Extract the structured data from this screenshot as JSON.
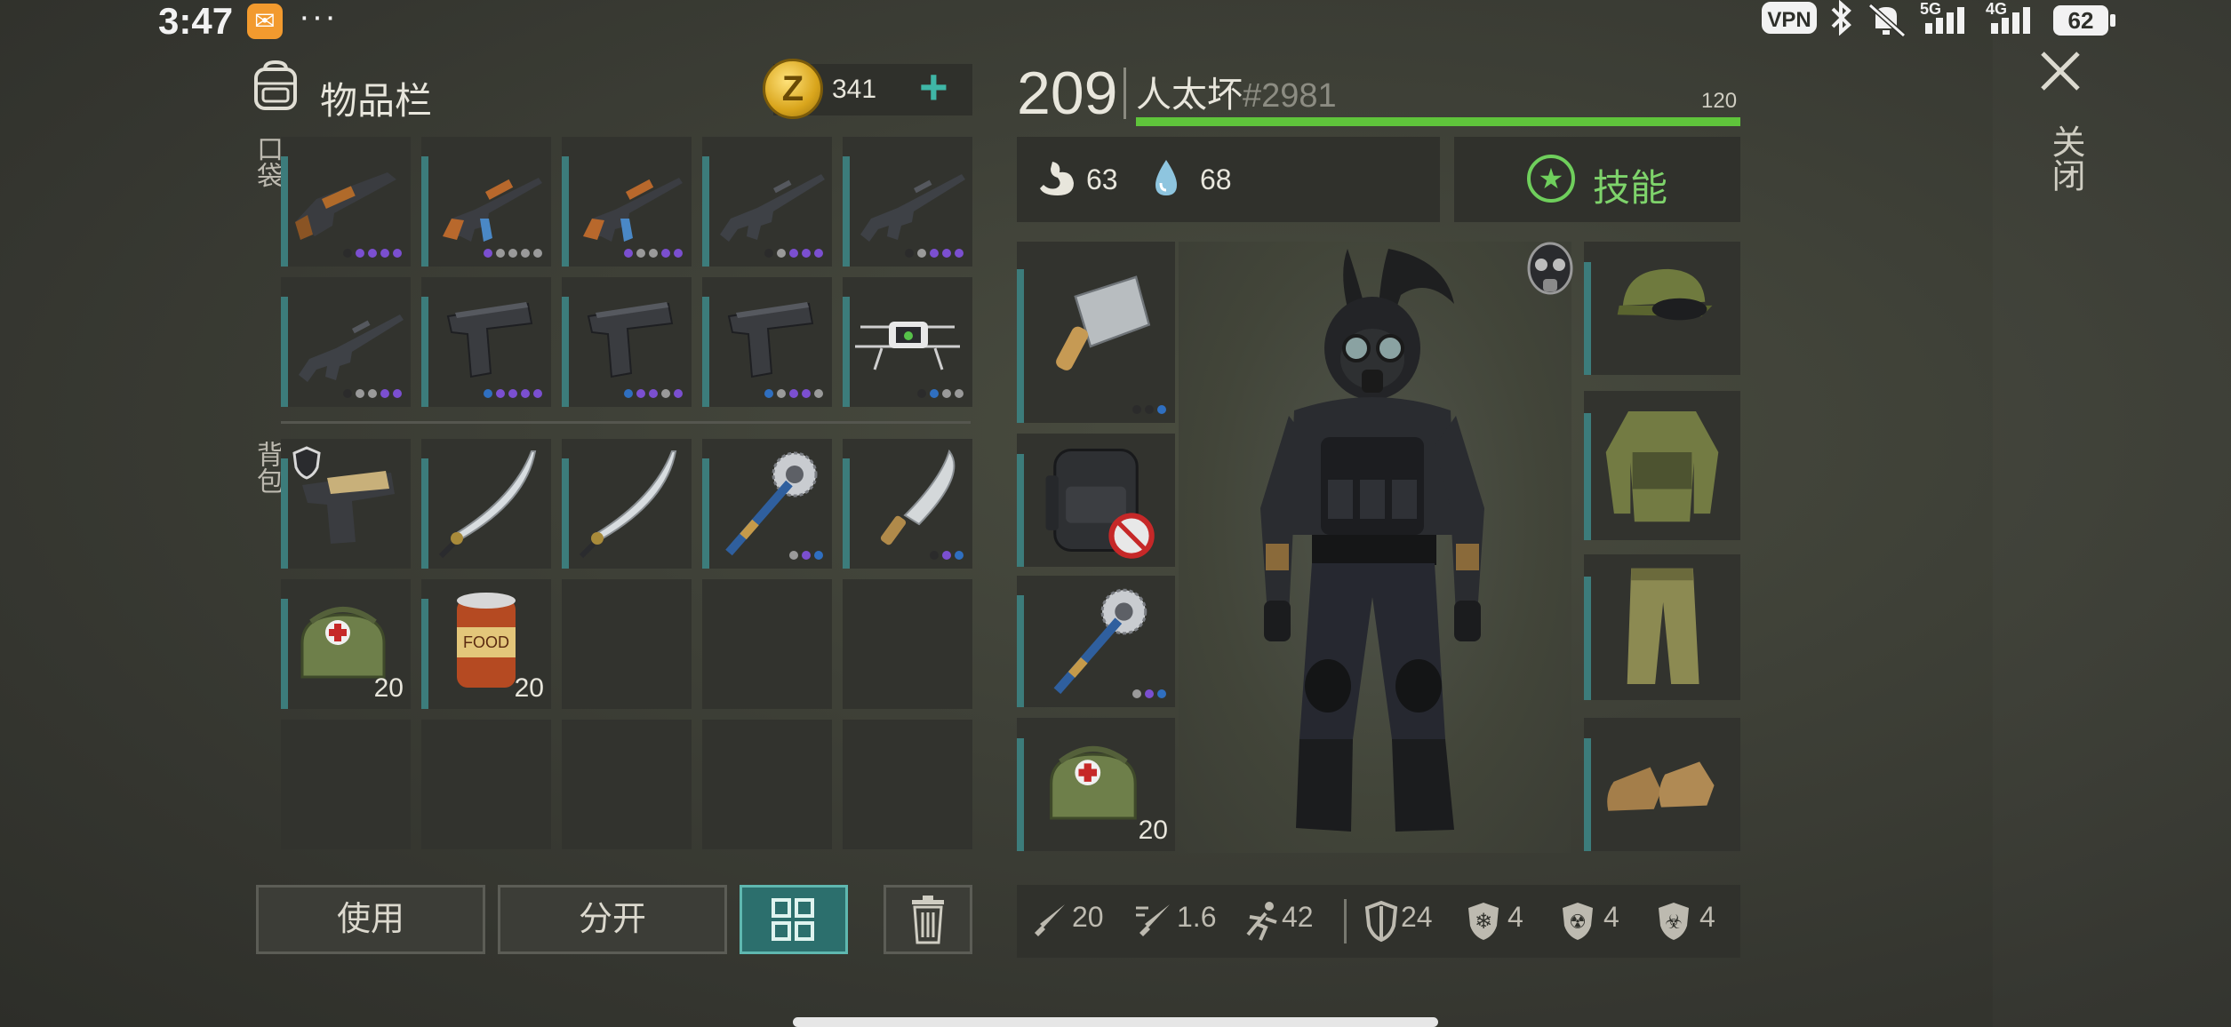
{
  "status_bar": {
    "time": "3:47",
    "dots": "···",
    "vpn": "VPN",
    "net1": "5G",
    "net2": "4G",
    "battery": "62"
  },
  "inventory": {
    "title": "物品栏",
    "currency": "341",
    "add": "+",
    "pocket_label": "口袋",
    "backpack_label": "背包",
    "pocket": [
      {
        "item": "pump-shotgun",
        "dots": [
          "#2b2b2b",
          "#7b4fd0",
          "#7b4fd0",
          "#7b4fd0",
          "#7b4fd0"
        ]
      },
      {
        "item": "ak-rifle",
        "dots": [
          "#7b4fd0",
          "#9a9a9a",
          "#9a9a9a",
          "#9a9a9a",
          "#9a9a9a"
        ]
      },
      {
        "item": "ak-rifle",
        "dots": [
          "#7b4fd0",
          "#9a9a9a",
          "#9a9a9a",
          "#7b4fd0",
          "#7b4fd0"
        ]
      },
      {
        "item": "assault-rifle",
        "dots": [
          "#2b2b2b",
          "#9a9a9a",
          "#7b4fd0",
          "#7b4fd0",
          "#7b4fd0"
        ]
      },
      {
        "item": "assault-rifle",
        "dots": [
          "#2b2b2b",
          "#9a9a9a",
          "#7b4fd0",
          "#7b4fd0",
          "#7b4fd0"
        ]
      },
      {
        "item": "assault-rifle",
        "dots": [
          "#2b2b2b",
          "#9a9a9a",
          "#9a9a9a",
          "#7b4fd0",
          "#7b4fd0"
        ]
      },
      {
        "item": "pistol",
        "dots": [
          "#2f6fc0",
          "#7b4fd0",
          "#7b4fd0",
          "#7b4fd0",
          "#7b4fd0"
        ]
      },
      {
        "item": "pistol",
        "dots": [
          "#2f6fc0",
          "#7b4fd0",
          "#7b4fd0",
          "#9a9a9a",
          "#7b4fd0"
        ]
      },
      {
        "item": "pistol",
        "dots": [
          "#2f6fc0",
          "#9a9a9a",
          "#7b4fd0",
          "#7b4fd0",
          "#9a9a9a"
        ]
      },
      {
        "item": "drone",
        "dots": [
          "#2b2b2b",
          "#2f6fc0",
          "#9a9a9a",
          "#9a9a9a"
        ]
      }
    ],
    "backpack": [
      {
        "item": "desert-eagle-pistol",
        "shield": true,
        "dots": []
      },
      {
        "item": "katana",
        "dots": []
      },
      {
        "item": "katana",
        "dots": []
      },
      {
        "item": "saw-mace",
        "dots": [
          "#9a9a9a",
          "#7b4fd0",
          "#2f6fc0"
        ]
      },
      {
        "item": "machete",
        "dots": [
          "#2b2b2b",
          "#7b4fd0",
          "#2f6fc0"
        ]
      },
      {
        "item": "medkit-bag",
        "qty": "20"
      },
      {
        "item": "canned-food",
        "qty": "20"
      },
      {
        "item": "empty"
      },
      {
        "item": "empty"
      },
      {
        "item": "empty"
      },
      {
        "item": "empty"
      },
      {
        "item": "empty"
      },
      {
        "item": "empty"
      },
      {
        "item": "empty"
      },
      {
        "item": "empty"
      }
    ]
  },
  "buttons": {
    "use": "使用",
    "split": "分开"
  },
  "character": {
    "level": "209",
    "name": "人太坏",
    "id": "#2981",
    "hp_max": "120",
    "hp_fraction": 1.0,
    "hunger": "63",
    "thirst": "68",
    "skills_label": "技能",
    "equip_left": [
      {
        "item": "cleaver",
        "dots": [
          "#2b2b2b",
          "#2b2b2b",
          "#2f6fc0"
        ]
      },
      {
        "item": "tactical-backpack"
      },
      {
        "item": "saw-mace",
        "dots": [
          "#9a9a9a",
          "#7b4fd0",
          "#2f6fc0"
        ]
      },
      {
        "item": "medkit-bag",
        "qty": "20"
      }
    ],
    "equip_right": [
      {
        "item": "camo-cap-sunglasses"
      },
      {
        "item": "camo-jacket"
      },
      {
        "item": "camo-pants"
      },
      {
        "item": "boots"
      }
    ],
    "stats": {
      "damage": "20",
      "attack_speed": "1.6",
      "speed": "42",
      "armor": "24",
      "cold": "4",
      "radiation": "4",
      "biohazard": "4"
    }
  },
  "close_label": "关闭"
}
